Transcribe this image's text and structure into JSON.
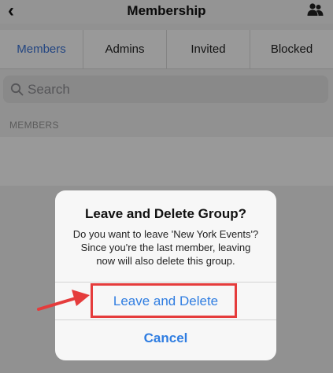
{
  "header": {
    "back_glyph": "‹",
    "title": "Membership",
    "right_icon": "people-icon"
  },
  "tabs": [
    {
      "label": "Members",
      "active": true
    },
    {
      "label": "Admins",
      "active": false
    },
    {
      "label": "Invited",
      "active": false
    },
    {
      "label": "Blocked",
      "active": false
    }
  ],
  "search": {
    "placeholder": "Search"
  },
  "section": {
    "label": "MEMBERS"
  },
  "dialog": {
    "title": "Leave and Delete Group?",
    "message": "Do you want to leave 'New York Events'? Since you're the last member, leaving now will also delete this group.",
    "primary_button": "Leave and Delete",
    "cancel_button": "Cancel"
  },
  "colors": {
    "accent_blue": "#2f7de1",
    "tab_active": "#3b74d8",
    "annotation_red": "#e53c3c"
  }
}
